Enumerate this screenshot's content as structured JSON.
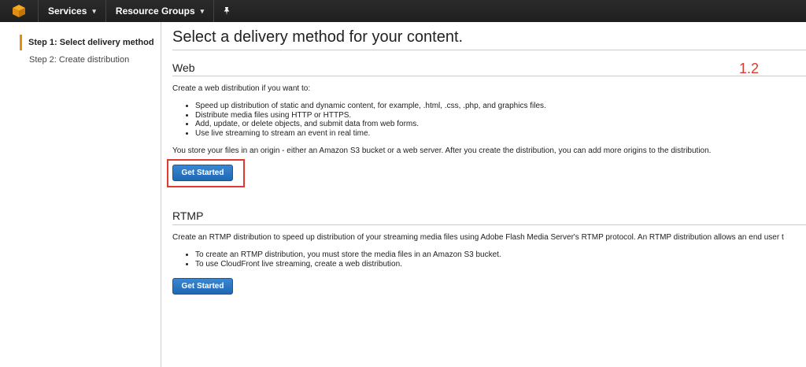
{
  "topbar": {
    "services_label": "Services",
    "resource_groups_label": "Resource Groups",
    "pin_icon": "pin-icon",
    "logo_icon": "aws-cube-icon"
  },
  "sidebar": {
    "steps": [
      {
        "label": "Step 1: Select delivery method",
        "active": true
      },
      {
        "label": "Step 2: Create distribution",
        "active": false
      }
    ]
  },
  "main": {
    "title": "Select a delivery method for your content.",
    "web": {
      "heading": "Web",
      "intro": "Create a web distribution if you want to:",
      "bullets": [
        "Speed up distribution of static and dynamic content, for example, .html, .css, .php, and graphics files.",
        "Distribute media files using HTTP or HTTPS.",
        "Add, update, or delete objects, and submit data from web forms.",
        "Use live streaming to stream an event in real time."
      ],
      "note": "You store your files in an origin - either an Amazon S3 bucket or a web server. After you create the distribution, you can add more origins to the distribution.",
      "button": "Get Started"
    },
    "rtmp": {
      "heading": "RTMP",
      "intro": "Create an RTMP distribution to speed up distribution of your streaming media files using Adobe Flash Media Server's RTMP protocol. An RTMP distribution allows an end user t",
      "bullets": [
        "To create an RTMP distribution, you must store the media files in an Amazon S3 bucket.",
        "To use CloudFront live streaming, create a web distribution."
      ],
      "button": "Get Started"
    }
  },
  "annotation": {
    "label": "1.2",
    "color": "#e0392f"
  },
  "colors": {
    "topbar": "#232f3e",
    "accent_step": "#e88c0c",
    "button": "#1f68b3"
  }
}
